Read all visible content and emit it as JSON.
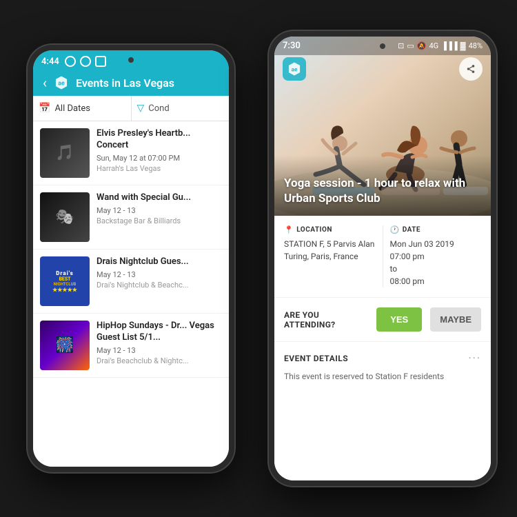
{
  "back_phone": {
    "status_bar": {
      "time": "4:44"
    },
    "app_bar": {
      "title": "Events in Las Vegas",
      "back_label": "‹"
    },
    "filter_bar": {
      "date_btn": "All Dates",
      "cond_btn": "Cond"
    },
    "events": [
      {
        "title": "Elvis Presley's Heartb... Concert",
        "date": "Sun, May 12 at 07:00 PM",
        "venue": "Harrah's Las Vegas",
        "thumb_type": "concert"
      },
      {
        "title": "Wand with Special Gu...",
        "date": "May 12 - 13",
        "venue": "Backstage Bar & Billiards",
        "thumb_type": "stage"
      },
      {
        "title": "Drais Nightclub Gues...",
        "date": "May 12 - 13",
        "venue": "Drai's Nightclub & Beachc...",
        "thumb_type": "drais"
      },
      {
        "title": "HipHop Sundays - Dr... Vegas Guest List 5/1...",
        "date": "May 12 - 13",
        "venue": "Drai's Beachclub & Nightc...",
        "thumb_type": "hiphop"
      }
    ]
  },
  "front_phone": {
    "status_bar": {
      "time": "7:30",
      "signal_label": "4G",
      "battery_label": "48%"
    },
    "hero": {
      "title": "Yoga session - 1 hour to relax with Urban Sports Club",
      "share_icon": "share"
    },
    "location": {
      "label": "LOCATION",
      "value": "STATION F, 5 Parvis Alan Turing, Paris, France"
    },
    "date": {
      "label": "DATE",
      "value": "Mon Jun 03 2019\n07:00 pm\nto\n08:00 pm"
    },
    "attending": {
      "question": "ARE YOU ATTENDING?",
      "yes_label": "YES",
      "maybe_label": "MAYBE"
    },
    "event_details": {
      "title": "EVENT DETAILS",
      "description": "This event is reserved to Station F residents"
    }
  }
}
